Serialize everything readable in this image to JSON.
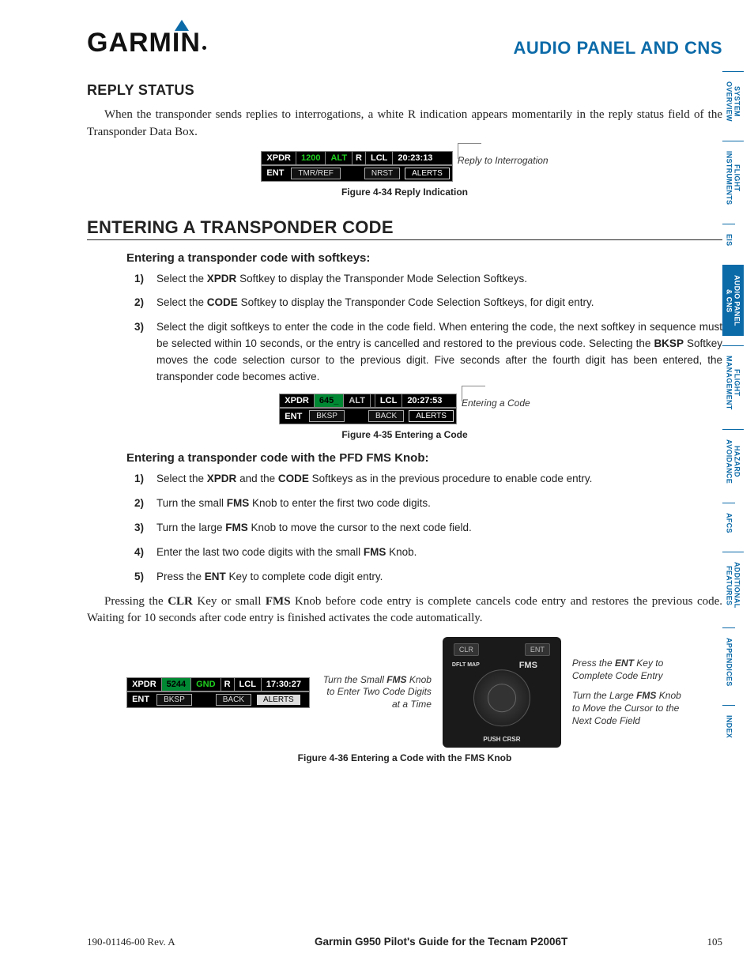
{
  "header": {
    "logo_text": "GARMIN",
    "chapter": "AUDIO PANEL AND CNS"
  },
  "sections": {
    "reply_status_title": "REPLY STATUS",
    "reply_status_para": "When the transponder sends replies to interrogations, a white R indication appears momentarily in the reply status field of the Transponder Data Box.",
    "entering_title": "ENTERING A TRANSPONDER CODE",
    "softkeys_title": "Entering a transponder code with softkeys:",
    "softkeys_steps": [
      "Select the <b>XPDR</b> Softkey to display the Transponder Mode Selection Softkeys.",
      "Select the <b>CODE</b> Softkey to display the Transponder Code Selection Softkeys, for digit entry.",
      "Select the digit softkeys to enter the code in the code field.  When entering the code, the next softkey in sequence must be selected within 10 seconds, or the entry is cancelled and restored to the previous code.  Selecting the <b>BKSP</b> Softkey moves the code selection cursor to the previous digit.  Five seconds after the fourth digit has been entered, the transponder code becomes active."
    ],
    "fmsknob_title": "Entering a transponder code with the PFD FMS Knob:",
    "fmsknob_steps": [
      "Select the <b>XPDR</b> and the <b>CODE</b> Softkeys as in the previous procedure to enable code entry.",
      "Turn the small <b>FMS</b> Knob to enter the first two code digits.",
      "Turn the large <b>FMS</b> Knob to move the cursor to the next code field.",
      "Enter the last two code digits with the small <b>FMS</b> Knob.",
      "Press the <b>ENT</b> Key to complete code digit entry."
    ],
    "closing_para": "Pressing the <span class='serif-b'>CLR</span> Key or small <span class='serif-b'>FMS</span> Knob before code entry is complete cancels code entry and restores the previous code.  Waiting for 10 seconds after code entry is finished activates the code automatically."
  },
  "figures": {
    "f34": {
      "caption": "Figure 4-34  Reply Indication",
      "callout": "Reply to Interrogation",
      "row1": [
        "XPDR",
        "1200",
        "ALT",
        "R",
        "LCL",
        "20:23:13"
      ],
      "row2": [
        "ENT",
        "TMR/REF",
        "",
        "NRST",
        "ALERTS"
      ]
    },
    "f35": {
      "caption": "Figure 4-35  Entering a Code",
      "callout": "Entering a Code",
      "row1": [
        "XPDR",
        "645_",
        "ALT",
        "",
        "LCL",
        "20:27:53"
      ],
      "row2": [
        "ENT",
        "BKSP",
        "",
        "BACK",
        "ALERTS"
      ]
    },
    "f36": {
      "caption": "Figure 4-36  Entering a Code with the FMS Knob",
      "call_left": "Turn the Small <b>FMS</b> Knob to Enter Two Code Digits at a Time",
      "call_r1": "Press the <b>ENT</b> Key to Complete Code Entry",
      "call_r2": "Turn the Large <b>FMS</b> Knob to Move the Cursor to the Next Code Field",
      "row1": [
        "XPDR",
        "5244",
        "GND",
        "R",
        "LCL",
        "17:30:27"
      ],
      "row2": [
        "ENT",
        "BKSP",
        "",
        "BACK",
        "ALERTS"
      ],
      "panel": {
        "clr": "CLR",
        "ent": "ENT",
        "fms": "FMS",
        "dflt": "DFLT MAP",
        "push": "PUSH CRSR"
      }
    }
  },
  "footer": {
    "left": "190-01146-00  Rev. A",
    "center": "Garmin G950 Pilot's Guide for the Tecnam P2006T",
    "right": "105"
  },
  "tabs": [
    {
      "label": "SYSTEM\nOVERVIEW",
      "active": false
    },
    {
      "label": "FLIGHT\nINSTRUMENTS",
      "active": false
    },
    {
      "label": "EIS",
      "active": false
    },
    {
      "label": "AUDIO PANEL\n& CNS",
      "active": true
    },
    {
      "label": "FLIGHT\nMANAGEMENT",
      "active": false
    },
    {
      "label": "HAZARD\nAVOIDANCE",
      "active": false
    },
    {
      "label": "AFCS",
      "active": false
    },
    {
      "label": "ADDITIONAL\nFEATURES",
      "active": false
    },
    {
      "label": "APPENDICES",
      "active": false
    },
    {
      "label": "INDEX",
      "active": false
    }
  ]
}
